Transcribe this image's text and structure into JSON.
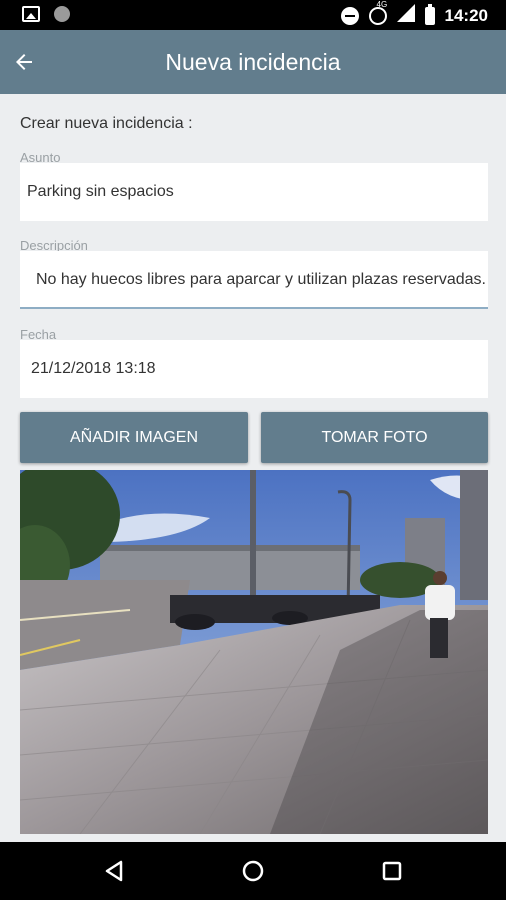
{
  "status_bar": {
    "time": "14:20",
    "network": "4G",
    "icons": [
      "image-icon",
      "circle-icon",
      "do-not-disturb-icon",
      "alarm-icon",
      "signal-icon",
      "battery-icon"
    ]
  },
  "app_bar": {
    "title": "Nueva incidencia",
    "back_icon": "arrow-left-icon",
    "color": "#627d8d"
  },
  "form": {
    "heading": "Crear nueva incidencia :",
    "asunto": {
      "label": "Asunto",
      "value": "Parking sin espacios"
    },
    "descripcion": {
      "label": "Descripción",
      "value": "No hay huecos libres para aparcar y utilizan plazas reservadas."
    },
    "fecha": {
      "label": "Fecha",
      "value": "21/12/2018 13:18"
    }
  },
  "buttons": {
    "add_image": "AÑADIR IMAGEN",
    "take_photo": "TOMAR FOTO"
  },
  "photo": {
    "subject": "street-sidewalk-photo"
  },
  "nav_bar": {
    "icons": [
      "back-triangle-icon",
      "home-circle-icon",
      "recents-square-icon"
    ]
  }
}
